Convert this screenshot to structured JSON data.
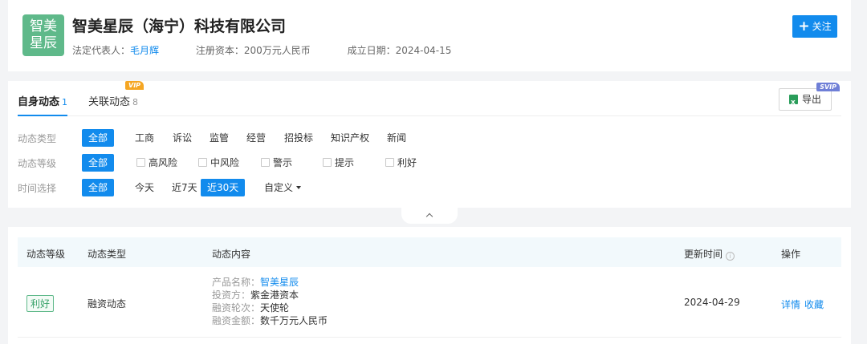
{
  "company": {
    "logo_line1": "智美",
    "logo_line2": "星辰",
    "name": "智美星辰（海宁）科技有限公司",
    "legal_rep_label": "法定代表人：",
    "legal_rep": "毛月辉",
    "capital_label": "注册资本：",
    "capital": "200万元人民币",
    "founded_label": "成立日期：",
    "founded": "2024-04-15",
    "follow_label": "关注"
  },
  "tabs": [
    {
      "label": "自身动态",
      "count": "1"
    },
    {
      "label": "关联动态",
      "count": "8"
    }
  ],
  "vip_badge": "VIP",
  "svip_badge": "SVIP",
  "export_label": "导出",
  "filters": {
    "type": {
      "label": "动态类型",
      "options": [
        "全部",
        "工商",
        "诉讼",
        "监管",
        "经营",
        "招投标",
        "知识产权",
        "新闻"
      ]
    },
    "level": {
      "label": "动态等级",
      "options": [
        "全部",
        "高风险",
        "中风险",
        "警示",
        "提示",
        "利好"
      ]
    },
    "time": {
      "label": "时间选择",
      "options": [
        "全部",
        "今天",
        "近7天",
        "近30天",
        "自定义"
      ]
    }
  },
  "table": {
    "headers": [
      "动态等级",
      "动态类型",
      "动态内容",
      "更新时间",
      "操作"
    ],
    "rows": [
      {
        "level": "利好",
        "type": "融资动态",
        "content": [
          {
            "k": "产品名称：",
            "v": "智美星辰"
          },
          {
            "k": "投资方：",
            "v": "紫金港资本"
          },
          {
            "k": "融资轮次：",
            "v": "天使轮"
          },
          {
            "k": "融资金额：",
            "v": "数千万元人民币"
          }
        ],
        "time": "2024-04-29",
        "actions": [
          "详情",
          "收藏"
        ]
      }
    ]
  },
  "colors": {
    "accent": "#128bed",
    "logo": "#5fb98a",
    "positive": "#3aa36b"
  }
}
